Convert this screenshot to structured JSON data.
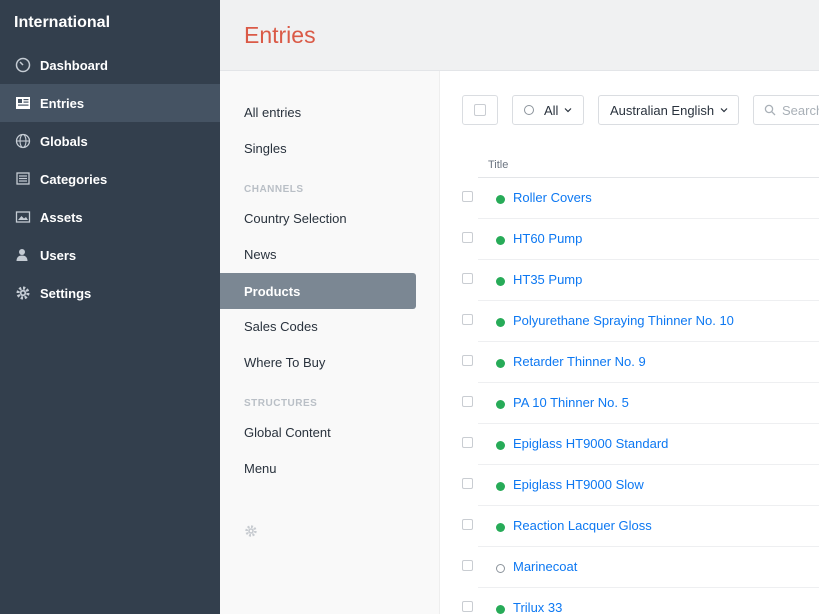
{
  "site": {
    "name": "International"
  },
  "nav": [
    {
      "label": "Dashboard",
      "icon": "dashboard-icon",
      "active": false
    },
    {
      "label": "Entries",
      "icon": "entries-icon",
      "active": true
    },
    {
      "label": "Globals",
      "icon": "globe-icon",
      "active": false
    },
    {
      "label": "Categories",
      "icon": "categories-icon",
      "active": false
    },
    {
      "label": "Assets",
      "icon": "assets-icon",
      "active": false
    },
    {
      "label": "Users",
      "icon": "users-icon",
      "active": false
    },
    {
      "label": "Settings",
      "icon": "gear-icon",
      "active": false
    }
  ],
  "header": {
    "title": "Entries"
  },
  "sources": {
    "all": "All entries",
    "singles": "Singles",
    "channels_heading": "CHANNELS",
    "channels": [
      "Country Selection",
      "News",
      "Products",
      "Sales Codes",
      "Where To Buy"
    ],
    "selected": "Products",
    "structures_heading": "STRUCTURES",
    "structures": [
      "Global Content",
      "Menu"
    ]
  },
  "toolbar": {
    "status_label": "All",
    "locale_label": "Australian English",
    "search_placeholder": "Search"
  },
  "table": {
    "column_title": "Title",
    "rows": [
      {
        "title": "Roller Covers",
        "status": "live"
      },
      {
        "title": "HT60 Pump",
        "status": "live"
      },
      {
        "title": "HT35 Pump",
        "status": "live"
      },
      {
        "title": "Polyurethane Spraying Thinner No. 10",
        "status": "live"
      },
      {
        "title": "Retarder Thinner No. 9",
        "status": "live"
      },
      {
        "title": "PA 10 Thinner No. 5",
        "status": "live"
      },
      {
        "title": "Epiglass HT9000 Standard",
        "status": "live"
      },
      {
        "title": "Epiglass HT9000 Slow",
        "status": "live"
      },
      {
        "title": "Reaction Lacquer Gloss",
        "status": "live"
      },
      {
        "title": "Marinecoat",
        "status": "disabled"
      },
      {
        "title": "Trilux 33",
        "status": "live"
      }
    ]
  },
  "colors": {
    "sidebar_bg": "#333f4d",
    "accent_title": "#da5a47",
    "link": "#0d78f2",
    "status_live": "#27ab58"
  }
}
